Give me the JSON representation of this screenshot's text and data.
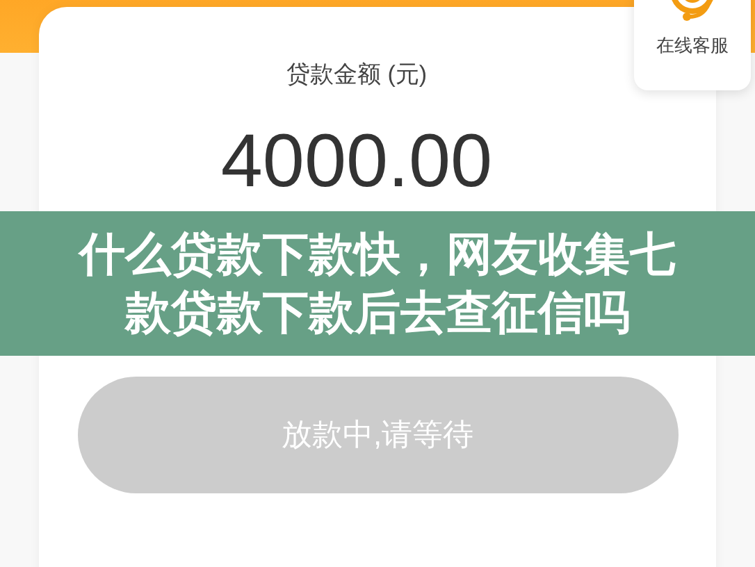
{
  "service_widget": {
    "label": "在线客服"
  },
  "loan_card": {
    "amount_label": "贷款金额 (元)",
    "amount": "4000.00"
  },
  "title_banner": {
    "text": "什么贷款下款快，网友收集七款贷款下款后去查征信吗"
  },
  "status_button": {
    "label": "放款中,请等待",
    "disabled": true
  }
}
